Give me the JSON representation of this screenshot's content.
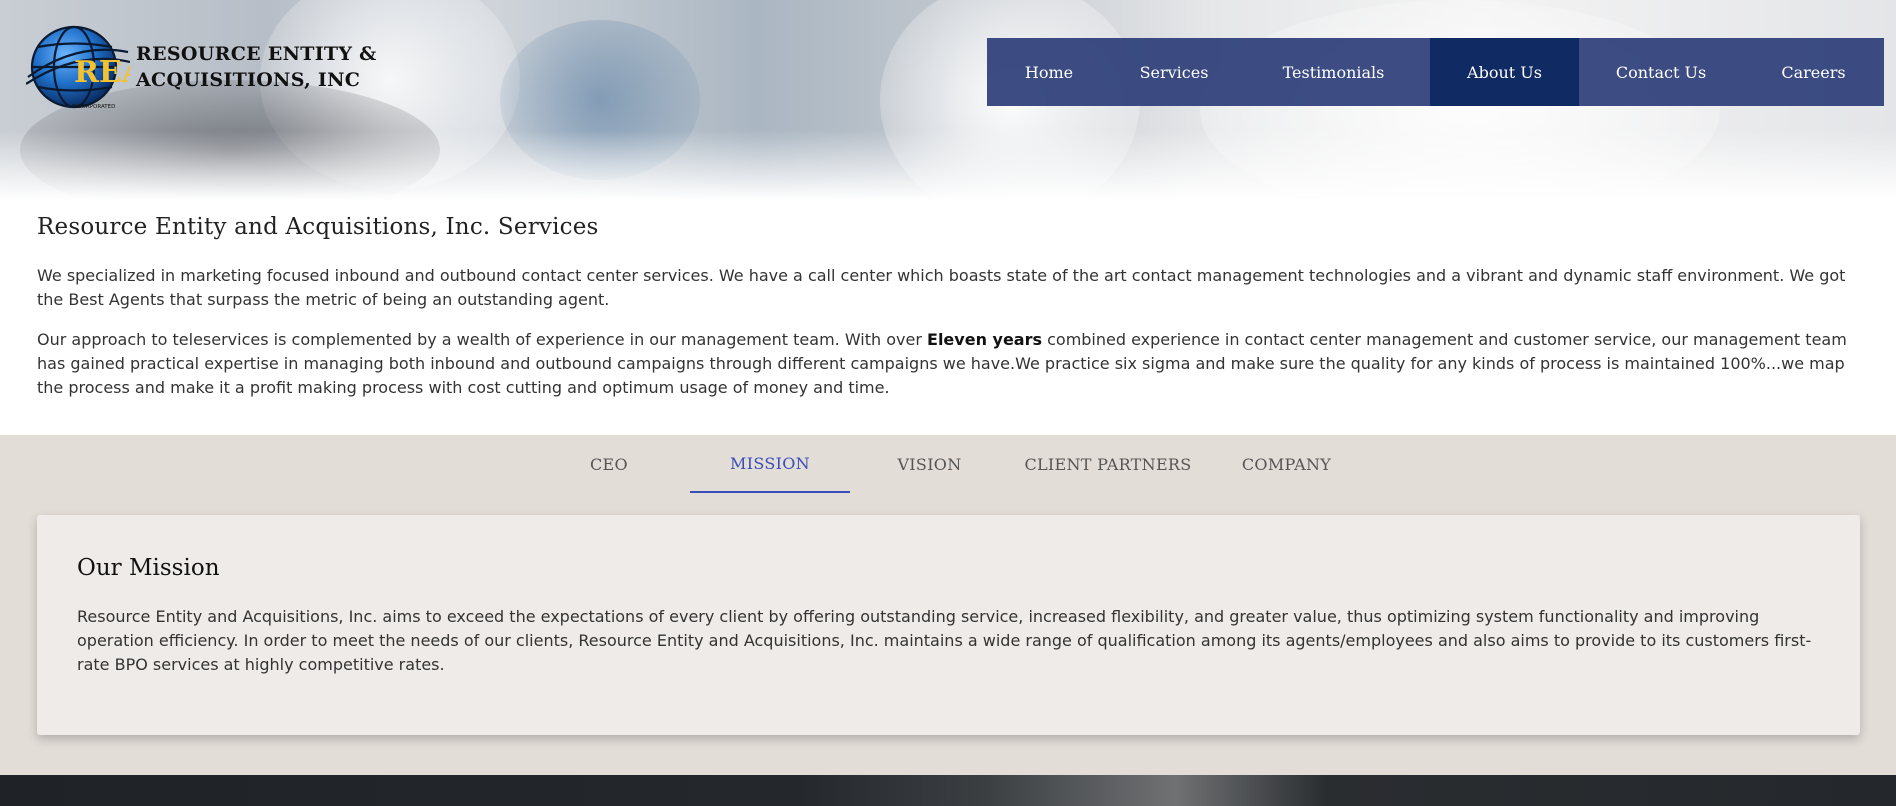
{
  "brand": {
    "name_line1": "RESOURCE ENTITY &",
    "name_line2": "ACQUISITIONS, INC",
    "monogram": "REA",
    "incorporated": "INCORPORATED"
  },
  "nav": {
    "items": [
      {
        "label": "Home"
      },
      {
        "label": "Services"
      },
      {
        "label": "Testimonials"
      },
      {
        "label": "About Us",
        "active": true
      },
      {
        "label": "Contact Us"
      },
      {
        "label": "Careers"
      }
    ]
  },
  "services": {
    "title": "Resource Entity and Acquisitions, Inc. Services",
    "p1": "We specialized in marketing focused inbound and outbound contact center services. We have a call center which boasts state of the art contact management technologies and a vibrant and dynamic staff environment. We got the Best Agents that surpass the metric of being an outstanding agent.",
    "p2_before": "Our approach to teleservices is complemented by a wealth of experience in our management team. With over ",
    "p2_bold": "Eleven years",
    "p2_after": " combined experience in contact center management and customer service, our management team has gained practical expertise in managing both inbound and outbound campaigns through different campaigns we have.We practice six sigma and make sure the quality for any kinds of process is maintained 100%...we map the process and make it a profit making process with cost cutting and optimum usage of money and time."
  },
  "tabs": {
    "items": [
      {
        "label": "CEO"
      },
      {
        "label": "MISSION",
        "active": true
      },
      {
        "label": "VISION"
      },
      {
        "label": "CLIENT PARTNERS"
      },
      {
        "label": "COMPANY"
      }
    ]
  },
  "mission": {
    "title": "Our Mission",
    "text": "Resource Entity and Acquisitions, Inc. aims to exceed the expectations of every client by offering outstanding service, increased flexibility, and greater value, thus optimizing system functionality and improving operation efficiency. In order to meet the needs of our clients, Resource Entity and Acquisitions, Inc. maintains a wide range of qualification among its agents/employees and also aims to provide to its customers first-rate BPO services at highly competitive rates."
  },
  "colors": {
    "nav_bg": "#2c3e78",
    "nav_active": "#102a63",
    "tab_active": "#3a4db8",
    "tabs_bg": "#e3ddd8",
    "card_bg": "#efebe8",
    "logo_globe": "#1f6fc9",
    "logo_letters": "#f2c230"
  }
}
